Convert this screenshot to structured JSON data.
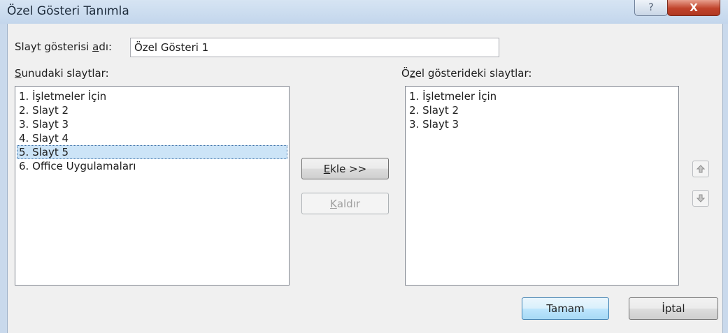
{
  "window": {
    "title": "Özel Gösteri Tanımla",
    "help_glyph": "?",
    "close_glyph": "X"
  },
  "show_name": {
    "label_pre": "Slayt gösterisi ",
    "label_access": "a",
    "label_post": "dı:",
    "value": "Özel Gösteri 1"
  },
  "presentation_slides": {
    "label_access": "S",
    "label_post": "unudaki slaytlar:",
    "items": [
      "1. İşletmeler İçin",
      "2. Slayt 2",
      "3. Slayt 3",
      "4. Slayt 4",
      "5. Slayt 5",
      "6. Office  Uygulamaları"
    ],
    "selected_index": 4
  },
  "custom_slides": {
    "label_pre": "Ö",
    "label_access": "z",
    "label_post": "el gösterideki slaytlar:",
    "items": [
      "1. İşletmeler İçin",
      "2. Slayt 2",
      "3. Slayt 3"
    ]
  },
  "buttons": {
    "add_access": "E",
    "add_post": "kle >>",
    "remove_access": "K",
    "remove_post": "aldır",
    "ok": "Tamam",
    "cancel": "İptal"
  },
  "icons": {
    "move_up": "arrow-up-icon",
    "move_down": "arrow-down-icon"
  },
  "colors": {
    "selection_bg": "#cce4f7",
    "default_button_border": "#3c7fb1",
    "close_button": "#c0432b"
  }
}
